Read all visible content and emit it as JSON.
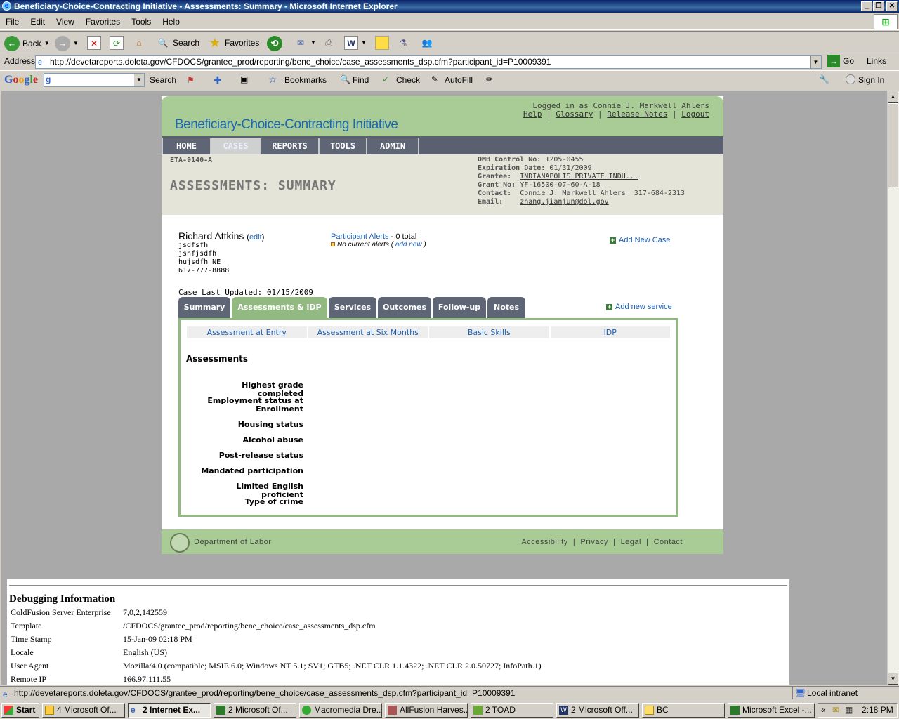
{
  "window": {
    "title": "Beneficiary-Choice-Contracting Initiative - Assessments: Summary - Microsoft Internet Explorer"
  },
  "menu": [
    "File",
    "Edit",
    "View",
    "Favorites",
    "Tools",
    "Help"
  ],
  "toolbar": {
    "back": "Back",
    "search": "Search",
    "favorites": "Favorites"
  },
  "address": {
    "label": "Address",
    "url": "http://devetareports.doleta.gov/CFDOCS/grantee_prod/reporting/bene_choice/case_assessments_dsp.cfm?participant_id=P10009391",
    "go": "Go",
    "links": "Links"
  },
  "googlebar": {
    "logo": "Google",
    "search": "Search",
    "bookmarks": "Bookmarks",
    "find": "Find",
    "check": "Check",
    "autofill": "AutoFill",
    "signin": "Sign In"
  },
  "site": {
    "title": "Beneficiary-Choice-Contracting Initiative",
    "logged_in": "Logged in as Connie J. Markwell Ahlers",
    "links": [
      "Help",
      "Glossary",
      "Release Notes",
      "Logout"
    ],
    "nav": [
      "HOME",
      "CASES",
      "REPORTS",
      "TOOLS",
      "ADMIN"
    ],
    "form_code": "ETA-9140-A",
    "page_heading": "ASSESSMENTS: SUMMARY",
    "omb": {
      "omb_label": "OMB Control No:",
      "omb_value": "1205-0455",
      "exp_label": "Expiration Date:",
      "exp_value": "01/31/2009",
      "grantee_label": "Grantee:",
      "grantee_value": "INDIANAPOLIS PRIVATE INDU...",
      "grant_label": "Grant No:",
      "grant_value": "YF-16500-07-60-A-18",
      "contact_label": "Contact:",
      "contact_value": "Connie J. Markwell Ahlers  317-684-2313",
      "email_label": "Email:",
      "email_value": "zhang.jianjun@dol.gov"
    }
  },
  "participant": {
    "name": "Richard Attkins",
    "edit": "edit",
    "address": [
      "jsdfsfh",
      "jshfjsdfh",
      "hujsdfh NE",
      "617-777-8888"
    ],
    "alerts_link": "Participant Alerts",
    "alerts_count": "- 0 total",
    "no_alerts": "No current alerts",
    "add_new": "add new",
    "add_case": "Add New Case",
    "last_updated": "Case Last Updated: 01/15/2009",
    "add_service": "Add new service"
  },
  "case_tabs": [
    "Summary",
    "Assessments & IDP",
    "Services",
    "Outcomes",
    "Follow-up",
    "Notes"
  ],
  "sub_tabs": [
    "Assessment at Entry",
    "Assessment at Six Months",
    "Basic Skills",
    "IDP"
  ],
  "assessments": {
    "heading": "Assessments",
    "labels": [
      "Highest grade completed",
      "Employment status at Enrollment",
      "Housing status",
      "Alcohol abuse",
      "Post-release status",
      "Mandated participation",
      "Limited English proficient",
      "Type of crime"
    ]
  },
  "footer": {
    "dept": "Department of Labor",
    "links": [
      "Accessibility",
      "Privacy",
      "Legal",
      "Contact"
    ]
  },
  "debug": {
    "title": "Debugging Information",
    "rows": [
      {
        "k": "ColdFusion Server Enterprise",
        "v": "7,0,2,142559"
      },
      {
        "k": "Template",
        "v": "/CFDOCS/grantee_prod/reporting/bene_choice/case_assessments_dsp.cfm"
      },
      {
        "k": "Time Stamp",
        "v": "15-Jan-09 02:18 PM"
      },
      {
        "k": "Locale",
        "v": "English (US)"
      },
      {
        "k": "User Agent",
        "v": "Mozilla/4.0 (compatible; MSIE 6.0; Windows NT 5.1; SV1; GTB5; .NET CLR 1.1.4322; .NET CLR 2.0.50727; InfoPath.1)"
      },
      {
        "k": "Remote IP",
        "v": "166.97.111.55"
      }
    ]
  },
  "status": {
    "url": "http://devetareports.doleta.gov/CFDOCS/grantee_prod/reporting/bene_choice/case_assessments_dsp.cfm?participant_id=P10009391",
    "zone": "Local intranet"
  },
  "taskbar": {
    "start": "Start",
    "tasks": [
      "4 Microsoft Of...",
      "2 Internet Ex...",
      "2 Microsoft Of...",
      "Macromedia Dre...",
      "AllFusion Harves...",
      "2 TOAD",
      "2 Microsoft Off...",
      "BC",
      "Microsoft Excel -..."
    ],
    "clock": "2:18 PM"
  }
}
